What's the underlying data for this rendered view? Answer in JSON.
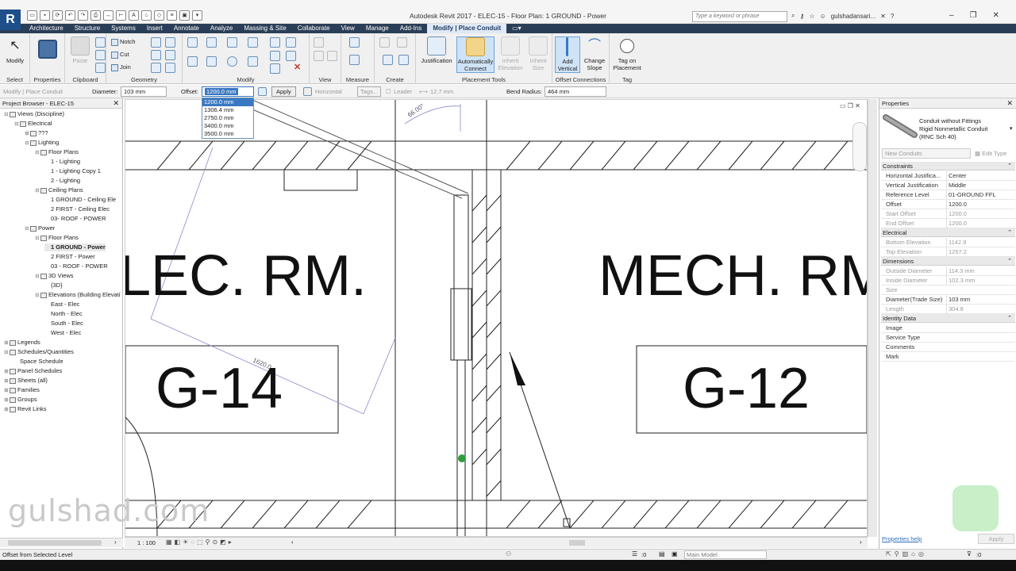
{
  "app": {
    "logo": "R",
    "title": "Autodesk Revit 2017 -    ELEC-15 - Floor Plan: 1 GROUND - Power",
    "search_placeholder": "Type a keyword or phrase",
    "user": "gulshadansari...",
    "help": "?"
  },
  "ribbon_tabs": [
    "Architecture",
    "Structure",
    "Systems",
    "Insert",
    "Annotate",
    "Analyze",
    "Massing & Site",
    "Collaborate",
    "View",
    "Manage",
    "Add-Ins",
    "Modify | Place Conduit"
  ],
  "ribbon_panels": {
    "select": "Select",
    "properties": "Properties",
    "clipboard": "Clipboard",
    "geometry": "Geometry",
    "modify": "Modify",
    "view": "View",
    "measure": "Measure",
    "create": "Create",
    "placement_tools": "Placement Tools",
    "offset_connections": "Offset Connections",
    "tag": "Tag"
  },
  "ribbon_buttons": {
    "modify": "Modify",
    "paste": "Paste",
    "notch": "Notch",
    "cut": "Cut",
    "join": "Join",
    "justification": "Justification",
    "auto_connect": "Automatically Connect",
    "inherit_elevation": "Inherit Elevation",
    "inherit_size": "Inherit Size",
    "add_vertical": "Add Vertical",
    "change_slope": "Change Slope",
    "tag_on_placement": "Tag on Placement"
  },
  "options_bar": {
    "context": "Modify | Place Conduit",
    "diameter_label": "Diameter:",
    "diameter_value": "103 mm",
    "offset_label": "Offset:",
    "offset_value": "1200.0 mm",
    "apply": "Apply",
    "horizontal": "Horizontal",
    "tags": "Tags...",
    "leader": "Leader",
    "leader_len": "12.7 mm",
    "bend_radius_label": "Bend Radius:",
    "bend_radius_value": "464 mm"
  },
  "offset_options": [
    "1200.0 mm",
    "1306.4 mm",
    "2750.0 mm",
    "3400.0 mm",
    "3500.0 mm"
  ],
  "project_browser": {
    "title": "Project Browser - ELEC-15",
    "items": [
      {
        "label": "Views (Discipline)",
        "level": 0,
        "tw": "⊟"
      },
      {
        "label": "Electrical",
        "level": 1,
        "tw": "⊟"
      },
      {
        "label": "???",
        "level": 2,
        "tw": "⊞"
      },
      {
        "label": "Lighting",
        "level": 2,
        "tw": "⊟"
      },
      {
        "label": "Floor Plans",
        "level": 3,
        "tw": "⊟"
      },
      {
        "label": "1 - Lighting",
        "level": 4,
        "tw": ""
      },
      {
        "label": "1 - Lighting Copy 1",
        "level": 4,
        "tw": ""
      },
      {
        "label": "2 - Lighting",
        "level": 4,
        "tw": ""
      },
      {
        "label": "Ceiling Plans",
        "level": 3,
        "tw": "⊟"
      },
      {
        "label": "1 GROUND - Ceiling Ele",
        "level": 4,
        "tw": ""
      },
      {
        "label": "2 FIRST - Ceiling Elec",
        "level": 4,
        "tw": ""
      },
      {
        "label": "03- ROOF - POWER",
        "level": 4,
        "tw": ""
      },
      {
        "label": "Power",
        "level": 2,
        "tw": "⊟"
      },
      {
        "label": "Floor Plans",
        "level": 3,
        "tw": "⊟"
      },
      {
        "label": "1 GROUND - Power",
        "level": 4,
        "tw": "",
        "bold": true
      },
      {
        "label": "2 FIRST - Power",
        "level": 4,
        "tw": ""
      },
      {
        "label": "03 - ROOF - POWER",
        "level": 4,
        "tw": ""
      },
      {
        "label": "3D Views",
        "level": 3,
        "tw": "⊟"
      },
      {
        "label": "{3D}",
        "level": 4,
        "tw": ""
      },
      {
        "label": "Elevations (Building Elevati",
        "level": 3,
        "tw": "⊟"
      },
      {
        "label": "East - Elec",
        "level": 4,
        "tw": ""
      },
      {
        "label": "North - Elec",
        "level": 4,
        "tw": ""
      },
      {
        "label": "South - Elec",
        "level": 4,
        "tw": ""
      },
      {
        "label": "West - Elec",
        "level": 4,
        "tw": ""
      },
      {
        "label": "Legends",
        "level": 0,
        "tw": "⊞"
      },
      {
        "label": "Schedules/Quantities",
        "level": 0,
        "tw": "⊟"
      },
      {
        "label": "Space Schedule",
        "level": 1,
        "tw": ""
      },
      {
        "label": "Panel Schedules",
        "level": 0,
        "tw": "⊞"
      },
      {
        "label": "Sheets (all)",
        "level": 0,
        "tw": "⊞"
      },
      {
        "label": "Families",
        "level": 0,
        "tw": "⊞"
      },
      {
        "label": "Groups",
        "level": 0,
        "tw": "⊞"
      },
      {
        "label": "Revit Links",
        "level": 0,
        "tw": "⊞"
      }
    ]
  },
  "canvas": {
    "room1_name": "LEC. RM.",
    "room1_number": "G-14",
    "room2_name": "MECH. RM",
    "room2_number": "G-12",
    "angle_label": "66.00°",
    "dim_label": "1620.0",
    "scale": "1 : 100"
  },
  "watermark": "gulshad.com",
  "properties": {
    "title": "Properties",
    "type_line1": "Conduit without Fittings",
    "type_line2": "Rigid Nonmetallic Conduit",
    "type_line3": "(RNC Sch 40)",
    "new_dropdown": "New Conduits",
    "edit_type": "Edit Type",
    "groups": [
      {
        "name": "Constraints",
        "rows": [
          [
            "Horizontal Justifica...",
            "Center",
            false
          ],
          [
            "Vertical Justification",
            "Middle",
            false
          ],
          [
            "Reference Level",
            "01-GROUND FFL",
            false
          ],
          [
            "Offset",
            "1200.0",
            false
          ],
          [
            "Start Offset",
            "1200.0",
            true
          ],
          [
            "End Offset",
            "1200.0",
            true
          ]
        ]
      },
      {
        "name": "Electrical",
        "rows": [
          [
            "Bottom Elevation",
            "1142.9",
            true
          ],
          [
            "Top Elevation",
            "1257.2",
            true
          ]
        ]
      },
      {
        "name": "Dimensions",
        "rows": [
          [
            "Outside Diameter",
            "114.3 mm",
            true
          ],
          [
            "Inside Diameter",
            "102.3 mm",
            true
          ],
          [
            "Size",
            "",
            true
          ],
          [
            "Diameter(Trade Size)",
            "103 mm",
            false
          ],
          [
            "Length",
            "304.8",
            true
          ]
        ]
      },
      {
        "name": "Identity Data",
        "rows": [
          [
            "Image",
            "",
            false
          ],
          [
            "Service Type",
            "",
            false
          ],
          [
            "Comments",
            "",
            false
          ],
          [
            "Mark",
            "",
            false
          ]
        ]
      }
    ],
    "help": "Properties help",
    "apply": "Apply"
  },
  "status": {
    "left": "Offset from Selected Level",
    "zero": ":0",
    "model": "Main Model",
    "filter": ":0"
  }
}
